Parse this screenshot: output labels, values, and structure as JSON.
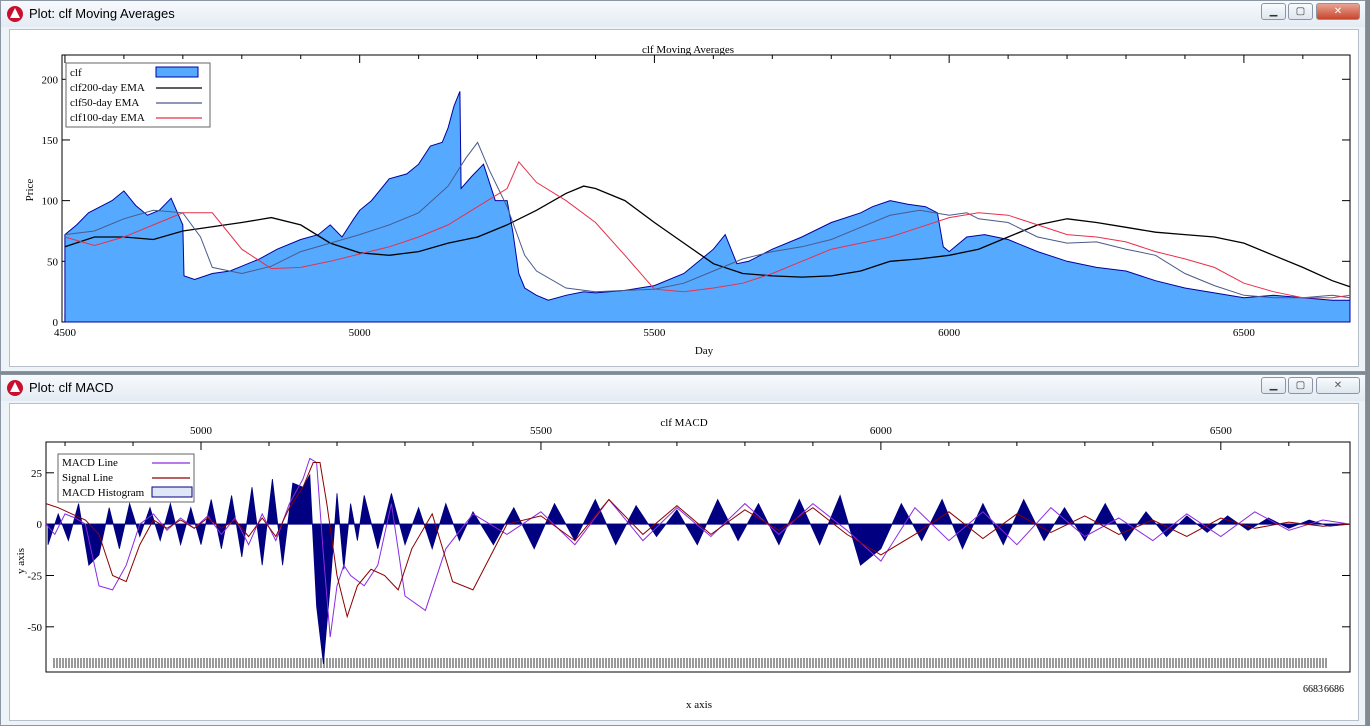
{
  "windows": {
    "top": {
      "title": "Plot: clf Moving Averages",
      "controls": [
        "minimize",
        "maximize",
        "close"
      ]
    },
    "bottom": {
      "title": "Plot: clf MACD",
      "controls": [
        "minimize",
        "maximize",
        "close"
      ]
    }
  },
  "colors": {
    "fill": "#55aaff",
    "fill_edge": "#0000a0",
    "ema200": "#000000",
    "ema50": "#4a5a8a",
    "ema100": "#e8304a",
    "macd": "#8a2be2",
    "signal": "#8b0000",
    "hist": "#000080"
  },
  "chart_data": [
    {
      "type": "area",
      "title": "clf Moving Averages",
      "xlabel": "Day",
      "ylabel": "Price",
      "xlim": [
        4495,
        6680
      ],
      "ylim": [
        0,
        220
      ],
      "xticks": [
        4500,
        5000,
        5500,
        6000,
        6500
      ],
      "yticks": [
        0,
        50,
        100,
        150,
        200
      ],
      "legend": "top-left",
      "grid": false,
      "series": [
        {
          "name": "clf",
          "style": "area",
          "x": [
            4500,
            4520,
            4540,
            4560,
            4580,
            4600,
            4620,
            4640,
            4660,
            4680,
            4700,
            4702,
            4720,
            4750,
            4780,
            4800,
            4830,
            4860,
            4900,
            4930,
            4950,
            4970,
            4990,
            5000,
            5020,
            5050,
            5080,
            5100,
            5120,
            5140,
            5150,
            5160,
            5170,
            5172,
            5190,
            5210,
            5230,
            5250,
            5260,
            5270,
            5280,
            5300,
            5320,
            5350,
            5380,
            5400,
            5450,
            5500,
            5550,
            5600,
            5620,
            5640,
            5660,
            5700,
            5750,
            5800,
            5850,
            5870,
            5900,
            5930,
            5960,
            5980,
            5990,
            6000,
            6030,
            6060,
            6100,
            6150,
            6200,
            6250,
            6300,
            6350,
            6400,
            6450,
            6500,
            6550,
            6600,
            6650,
            6680
          ],
          "y": [
            72,
            80,
            90,
            95,
            100,
            108,
            96,
            88,
            92,
            102,
            80,
            38,
            35,
            40,
            42,
            46,
            52,
            60,
            68,
            72,
            80,
            70,
            85,
            92,
            100,
            118,
            122,
            130,
            145,
            148,
            160,
            178,
            190,
            110,
            120,
            130,
            100,
            100,
            74,
            40,
            28,
            22,
            18,
            22,
            25,
            24,
            26,
            30,
            40,
            60,
            72,
            48,
            50,
            60,
            70,
            82,
            90,
            95,
            100,
            97,
            95,
            90,
            62,
            58,
            70,
            72,
            68,
            58,
            50,
            45,
            42,
            34,
            28,
            24,
            20,
            22,
            20,
            18,
            18
          ]
        },
        {
          "name": "clf200-day EMA",
          "style": "line",
          "x": [
            4500,
            4550,
            4600,
            4650,
            4700,
            4800,
            4850,
            4900,
            4950,
            5000,
            5050,
            5100,
            5150,
            5200,
            5250,
            5300,
            5350,
            5380,
            5400,
            5450,
            5500,
            5550,
            5600,
            5650,
            5700,
            5750,
            5800,
            5850,
            5900,
            5950,
            6000,
            6050,
            6100,
            6150,
            6200,
            6250,
            6300,
            6350,
            6400,
            6450,
            6500,
            6550,
            6600,
            6650,
            6680
          ],
          "y": [
            62,
            70,
            70,
            68,
            75,
            82,
            86,
            80,
            65,
            57,
            55,
            58,
            65,
            70,
            80,
            92,
            106,
            112,
            110,
            100,
            82,
            65,
            48,
            40,
            38,
            37,
            38,
            42,
            50,
            52,
            55,
            60,
            70,
            80,
            85,
            82,
            78,
            74,
            72,
            70,
            65,
            55,
            45,
            34,
            29
          ]
        },
        {
          "name": "clf50-day EMA",
          "style": "line",
          "x": [
            4500,
            4550,
            4600,
            4650,
            4700,
            4730,
            4750,
            4800,
            4850,
            4900,
            4950,
            5000,
            5050,
            5100,
            5150,
            5180,
            5200,
            5220,
            5250,
            5280,
            5300,
            5350,
            5400,
            5450,
            5500,
            5550,
            5600,
            5650,
            5700,
            5750,
            5800,
            5850,
            5900,
            5950,
            6000,
            6030,
            6050,
            6100,
            6150,
            6200,
            6250,
            6300,
            6350,
            6400,
            6450,
            6500,
            6550,
            6600,
            6650,
            6680
          ],
          "y": [
            72,
            75,
            85,
            92,
            90,
            70,
            45,
            40,
            46,
            58,
            65,
            72,
            80,
            90,
            112,
            135,
            148,
            125,
            95,
            55,
            42,
            28,
            25,
            26,
            27,
            32,
            42,
            52,
            58,
            62,
            68,
            78,
            88,
            92,
            88,
            90,
            85,
            82,
            70,
            65,
            66,
            60,
            55,
            40,
            30,
            22,
            20,
            20,
            22,
            20
          ]
        },
        {
          "name": "clf100-day EMA",
          "style": "line",
          "x": [
            4500,
            4550,
            4600,
            4650,
            4700,
            4750,
            4800,
            4850,
            4900,
            4950,
            5000,
            5050,
            5100,
            5150,
            5200,
            5250,
            5270,
            5300,
            5350,
            5400,
            5450,
            5500,
            5550,
            5600,
            5650,
            5700,
            5750,
            5800,
            5850,
            5900,
            5950,
            6000,
            6050,
            6100,
            6150,
            6200,
            6250,
            6300,
            6350,
            6400,
            6450,
            6500,
            6550,
            6600,
            6650,
            6680
          ],
          "y": [
            70,
            63,
            70,
            80,
            90,
            90,
            60,
            44,
            45,
            50,
            56,
            62,
            70,
            80,
            95,
            110,
            132,
            115,
            100,
            82,
            55,
            27,
            25,
            28,
            32,
            40,
            50,
            60,
            65,
            70,
            78,
            86,
            90,
            88,
            80,
            72,
            70,
            66,
            58,
            52,
            45,
            32,
            25,
            20,
            20,
            22
          ]
        }
      ]
    },
    {
      "type": "line",
      "title": "clf MACD",
      "xlabel": "x axis",
      "ylabel": "y axis",
      "xlim": [
        4772,
        6690
      ],
      "ylim": [
        -72,
        40
      ],
      "xticks": [
        5000,
        5500,
        6000,
        6500
      ],
      "yticks": [
        -50,
        -25,
        0,
        25
      ],
      "bottom_tick_labels": [
        "6683",
        "6686"
      ],
      "legend": "top-left",
      "grid": false,
      "series": [
        {
          "name": "MACD Line",
          "style": "line",
          "x": [
            4772,
            4785,
            4800,
            4815,
            4830,
            4850,
            4870,
            4890,
            4910,
            4930,
            4950,
            4970,
            4990,
            5010,
            5030,
            5050,
            5070,
            5090,
            5110,
            5130,
            5150,
            5160,
            5170,
            5180,
            5190,
            5200,
            5210,
            5220,
            5240,
            5260,
            5280,
            5300,
            5330,
            5360,
            5400,
            5450,
            5500,
            5550,
            5600,
            5650,
            5700,
            5750,
            5800,
            5850,
            5900,
            5950,
            6000,
            6050,
            6100,
            6150,
            6200,
            6250,
            6300,
            6350,
            6400,
            6450,
            6500,
            6550,
            6600,
            6650,
            6690
          ],
          "y": [
            0,
            -5,
            5,
            3,
            0,
            -30,
            -32,
            -20,
            0,
            5,
            -3,
            3,
            -2,
            4,
            -5,
            3,
            -10,
            5,
            -8,
            10,
            22,
            32,
            30,
            -15,
            -55,
            -30,
            -20,
            -25,
            -30,
            -20,
            10,
            -35,
            -42,
            -12,
            5,
            -5,
            6,
            -10,
            12,
            -8,
            8,
            -6,
            10,
            -5,
            10,
            -3,
            -18,
            8,
            -8,
            6,
            -10,
            8,
            -6,
            3,
            -8,
            5,
            -6,
            6,
            -3,
            2,
            0
          ]
        },
        {
          "name": "Signal Line",
          "style": "line",
          "x": [
            4772,
            4790,
            4810,
            4830,
            4850,
            4870,
            4890,
            4910,
            4930,
            4950,
            4970,
            4990,
            5010,
            5030,
            5050,
            5070,
            5090,
            5110,
            5130,
            5150,
            5165,
            5175,
            5185,
            5200,
            5215,
            5230,
            5250,
            5270,
            5290,
            5310,
            5340,
            5370,
            5400,
            5450,
            5500,
            5550,
            5600,
            5650,
            5700,
            5750,
            5800,
            5850,
            5900,
            5950,
            6000,
            6050,
            6100,
            6150,
            6200,
            6250,
            6300,
            6350,
            6400,
            6450,
            6500,
            6550,
            6600,
            6650,
            6690
          ],
          "y": [
            10,
            8,
            5,
            2,
            -5,
            -25,
            -28,
            -10,
            2,
            -2,
            2,
            -2,
            3,
            -2,
            2,
            -6,
            3,
            -6,
            8,
            18,
            30,
            30,
            10,
            -25,
            -45,
            -30,
            -22,
            -25,
            -32,
            -12,
            5,
            -28,
            -32,
            0,
            4,
            -8,
            12,
            -5,
            9,
            -5,
            7,
            -3,
            8,
            -5,
            -15,
            -5,
            6,
            -7,
            5,
            -4,
            4,
            -5,
            2,
            -6,
            3,
            -2,
            1,
            -1,
            0
          ]
        },
        {
          "name": "MACD Histogram",
          "style": "bar",
          "x": [
            4775,
            4790,
            4805,
            4820,
            4835,
            4850,
            4865,
            4880,
            4895,
            4910,
            4925,
            4940,
            4955,
            4970,
            4985,
            5000,
            5015,
            5030,
            5045,
            5060,
            5075,
            5090,
            5105,
            5120,
            5135,
            5150,
            5160,
            5170,
            5180,
            5190,
            5200,
            5210,
            5220,
            5230,
            5240,
            5260,
            5280,
            5300,
            5320,
            5340,
            5360,
            5380,
            5400,
            5430,
            5460,
            5490,
            5520,
            5550,
            5580,
            5610,
            5640,
            5670,
            5700,
            5730,
            5760,
            5790,
            5820,
            5850,
            5880,
            5910,
            5940,
            5970,
            6000,
            6030,
            6060,
            6090,
            6120,
            6150,
            6180,
            6210,
            6240,
            6270,
            6300,
            6330,
            6360,
            6390,
            6420,
            6450,
            6480,
            6510,
            6540,
            6570,
            6600,
            6630,
            6660,
            6690
          ],
          "y": [
            -10,
            5,
            -8,
            10,
            -20,
            -15,
            8,
            -12,
            10,
            -6,
            8,
            -8,
            10,
            -10,
            8,
            -10,
            12,
            -12,
            14,
            -16,
            18,
            -20,
            22,
            -20,
            20,
            18,
            24,
            -40,
            -68,
            -30,
            15,
            -22,
            10,
            -8,
            14,
            -12,
            15,
            -10,
            8,
            -12,
            10,
            -8,
            6,
            -10,
            8,
            -12,
            10,
            -8,
            12,
            -10,
            9,
            -6,
            7,
            -10,
            12,
            -8,
            10,
            -10,
            12,
            -10,
            14,
            -20,
            -12,
            10,
            -8,
            12,
            -12,
            10,
            -10,
            12,
            -8,
            8,
            -8,
            10,
            -8,
            6,
            -6,
            4,
            -4,
            4,
            -3,
            3,
            -2,
            2,
            -1,
            0
          ]
        }
      ]
    }
  ]
}
